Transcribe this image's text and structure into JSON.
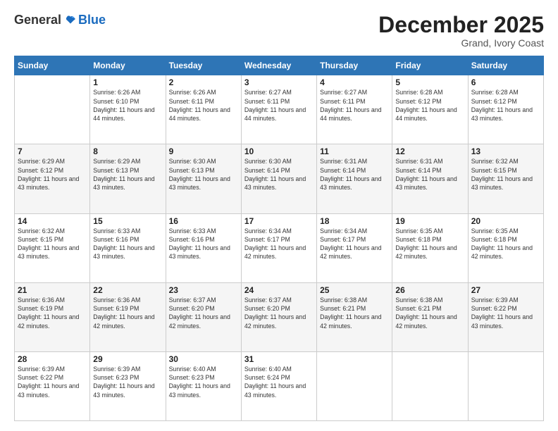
{
  "logo": {
    "general": "General",
    "blue": "Blue"
  },
  "header": {
    "title": "December 2025",
    "subtitle": "Grand, Ivory Coast"
  },
  "calendar": {
    "days": [
      "Sunday",
      "Monday",
      "Tuesday",
      "Wednesday",
      "Thursday",
      "Friday",
      "Saturday"
    ],
    "weeks": [
      [
        {
          "day": "",
          "info": ""
        },
        {
          "day": "1",
          "info": "Sunrise: 6:26 AM\nSunset: 6:10 PM\nDaylight: 11 hours and 44 minutes."
        },
        {
          "day": "2",
          "info": "Sunrise: 6:26 AM\nSunset: 6:11 PM\nDaylight: 11 hours and 44 minutes."
        },
        {
          "day": "3",
          "info": "Sunrise: 6:27 AM\nSunset: 6:11 PM\nDaylight: 11 hours and 44 minutes."
        },
        {
          "day": "4",
          "info": "Sunrise: 6:27 AM\nSunset: 6:11 PM\nDaylight: 11 hours and 44 minutes."
        },
        {
          "day": "5",
          "info": "Sunrise: 6:28 AM\nSunset: 6:12 PM\nDaylight: 11 hours and 44 minutes."
        },
        {
          "day": "6",
          "info": "Sunrise: 6:28 AM\nSunset: 6:12 PM\nDaylight: 11 hours and 43 minutes."
        }
      ],
      [
        {
          "day": "7",
          "info": "Sunrise: 6:29 AM\nSunset: 6:12 PM\nDaylight: 11 hours and 43 minutes."
        },
        {
          "day": "8",
          "info": "Sunrise: 6:29 AM\nSunset: 6:13 PM\nDaylight: 11 hours and 43 minutes."
        },
        {
          "day": "9",
          "info": "Sunrise: 6:30 AM\nSunset: 6:13 PM\nDaylight: 11 hours and 43 minutes."
        },
        {
          "day": "10",
          "info": "Sunrise: 6:30 AM\nSunset: 6:14 PM\nDaylight: 11 hours and 43 minutes."
        },
        {
          "day": "11",
          "info": "Sunrise: 6:31 AM\nSunset: 6:14 PM\nDaylight: 11 hours and 43 minutes."
        },
        {
          "day": "12",
          "info": "Sunrise: 6:31 AM\nSunset: 6:14 PM\nDaylight: 11 hours and 43 minutes."
        },
        {
          "day": "13",
          "info": "Sunrise: 6:32 AM\nSunset: 6:15 PM\nDaylight: 11 hours and 43 minutes."
        }
      ],
      [
        {
          "day": "14",
          "info": "Sunrise: 6:32 AM\nSunset: 6:15 PM\nDaylight: 11 hours and 43 minutes."
        },
        {
          "day": "15",
          "info": "Sunrise: 6:33 AM\nSunset: 6:16 PM\nDaylight: 11 hours and 43 minutes."
        },
        {
          "day": "16",
          "info": "Sunrise: 6:33 AM\nSunset: 6:16 PM\nDaylight: 11 hours and 43 minutes."
        },
        {
          "day": "17",
          "info": "Sunrise: 6:34 AM\nSunset: 6:17 PM\nDaylight: 11 hours and 42 minutes."
        },
        {
          "day": "18",
          "info": "Sunrise: 6:34 AM\nSunset: 6:17 PM\nDaylight: 11 hours and 42 minutes."
        },
        {
          "day": "19",
          "info": "Sunrise: 6:35 AM\nSunset: 6:18 PM\nDaylight: 11 hours and 42 minutes."
        },
        {
          "day": "20",
          "info": "Sunrise: 6:35 AM\nSunset: 6:18 PM\nDaylight: 11 hours and 42 minutes."
        }
      ],
      [
        {
          "day": "21",
          "info": "Sunrise: 6:36 AM\nSunset: 6:19 PM\nDaylight: 11 hours and 42 minutes."
        },
        {
          "day": "22",
          "info": "Sunrise: 6:36 AM\nSunset: 6:19 PM\nDaylight: 11 hours and 42 minutes."
        },
        {
          "day": "23",
          "info": "Sunrise: 6:37 AM\nSunset: 6:20 PM\nDaylight: 11 hours and 42 minutes."
        },
        {
          "day": "24",
          "info": "Sunrise: 6:37 AM\nSunset: 6:20 PM\nDaylight: 11 hours and 42 minutes."
        },
        {
          "day": "25",
          "info": "Sunrise: 6:38 AM\nSunset: 6:21 PM\nDaylight: 11 hours and 42 minutes."
        },
        {
          "day": "26",
          "info": "Sunrise: 6:38 AM\nSunset: 6:21 PM\nDaylight: 11 hours and 42 minutes."
        },
        {
          "day": "27",
          "info": "Sunrise: 6:39 AM\nSunset: 6:22 PM\nDaylight: 11 hours and 43 minutes."
        }
      ],
      [
        {
          "day": "28",
          "info": "Sunrise: 6:39 AM\nSunset: 6:22 PM\nDaylight: 11 hours and 43 minutes."
        },
        {
          "day": "29",
          "info": "Sunrise: 6:39 AM\nSunset: 6:23 PM\nDaylight: 11 hours and 43 minutes."
        },
        {
          "day": "30",
          "info": "Sunrise: 6:40 AM\nSunset: 6:23 PM\nDaylight: 11 hours and 43 minutes."
        },
        {
          "day": "31",
          "info": "Sunrise: 6:40 AM\nSunset: 6:24 PM\nDaylight: 11 hours and 43 minutes."
        },
        {
          "day": "",
          "info": ""
        },
        {
          "day": "",
          "info": ""
        },
        {
          "day": "",
          "info": ""
        }
      ]
    ]
  }
}
